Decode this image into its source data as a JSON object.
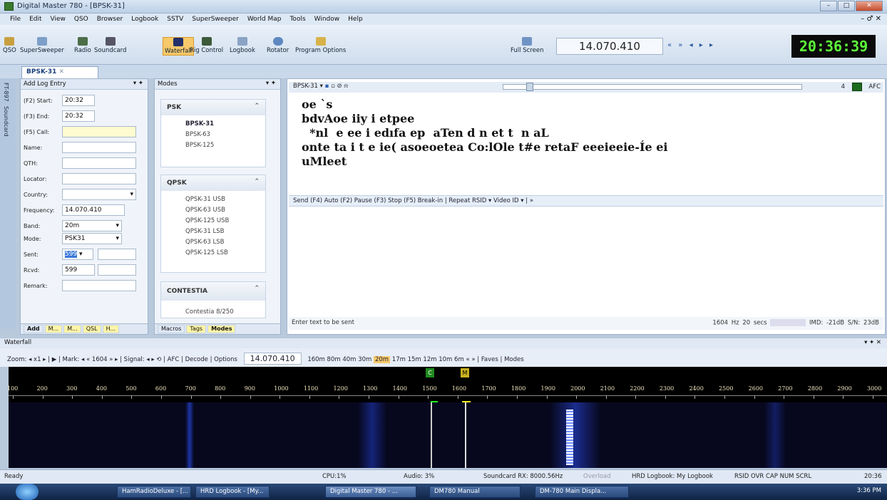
{
  "window": {
    "title": "Digital Master 780 - [BPSK-31]",
    "min": "–",
    "max": "□",
    "close": "✕"
  },
  "menu": [
    "File",
    "Edit",
    "View",
    "QSO",
    "Browser",
    "Logbook",
    "SSTV",
    "SuperSweeper",
    "World Map",
    "Tools",
    "Window",
    "Help"
  ],
  "menu_right": "– ♂ ✕",
  "toolbar": {
    "items": [
      "QSO",
      "SuperSweeper",
      "Radio",
      "Soundcard",
      "Waterfall",
      "Rig Control",
      "Logbook",
      "Rotator",
      "Program Options"
    ],
    "full_screen": "Full Screen",
    "frequency": "14.070.410",
    "clock": "20:36:39",
    "colors": {
      "clock_bg": "#0b0b0b",
      "clock_fg": "#5dff3a"
    }
  },
  "doc_tab": "BPSK-31",
  "vertical_tabs": [
    "FT-897",
    "Soundcard"
  ],
  "log": {
    "title": "Add Log Entry",
    "start_label": "(F2) Start:",
    "start": "20:32",
    "end_label": "(F3) End:",
    "end": "20:32",
    "call_label": "(F5) Call:",
    "name_label": "Name:",
    "qth_label": "QTH:",
    "locator_label": "Locator:",
    "country_label": "Country:",
    "frequency_label": "Frequency:",
    "frequency": "14.070.410",
    "band_label": "Band:",
    "band": "20m",
    "mode_label": "Mode:",
    "mode": "PSK31",
    "sent_label": "Sent:",
    "sent": "599",
    "rcvd_label": "Rcvd:",
    "rcvd": "599",
    "remark_label": "Remark:",
    "tabs": [
      "Add",
      "M...",
      "M...",
      "QSL",
      "H..."
    ]
  },
  "modes": {
    "title": "Modes",
    "groups": [
      {
        "name": "PSK",
        "items": [
          "BPSK-31",
          "BPSK-63",
          "BPSK-125"
        ]
      },
      {
        "name": "QPSK",
        "items": [
          "QPSK-31 USB",
          "QPSK-63 USB",
          "QPSK-125 USB",
          "QPSK-31 LSB",
          "QPSK-63 LSB",
          "QPSK-125 LSB"
        ]
      },
      {
        "name": "CONTESTIA",
        "items": [
          "Contestia 8/250"
        ]
      }
    ],
    "tabs": [
      "Macros",
      "Tags",
      "Modes"
    ]
  },
  "rx": {
    "mode_label": "BPSK-31",
    "afc": "AFC",
    "level": "4",
    "lines": [
      "oe `s",
      "bdvAoe  iiy i etpee",
      "  *nl  e ee i edıfa ep  aTen d n et t  n aL",
      "onte ta  i t e  ie(  asoeoetea  Co:lOle t#e  retaF eeeieeie-Íe ei",
      "uMleet"
    ]
  },
  "tx": {
    "toolbar": "Send (F4)  Auto (F2)  Pause (F3)  Stop (F5)  Break-in  |  Repeat  RSID ▾  Video ID ▾  |  »",
    "status_left": "Enter text to be sent",
    "status_hz": "1604 Hz",
    "status_secs": "20 secs",
    "status_imd": "IMD: -21dB  S/N: 23dB"
  },
  "waterfall": {
    "title": "Waterfall",
    "bar_left": "Zoom:  ◂  x1  ▸  |   ▶  |  Mark:  ◂  «  1604  »  ▸  |  Signal:  ◂  ▸  ⟲  |  AFC  |  Decode  |  Options",
    "frequency": "14.070.410",
    "bands": [
      "160m",
      "80m",
      "40m",
      "30m",
      "20m",
      "17m",
      "15m",
      "12m",
      "10m",
      "6m"
    ],
    "active_band": "20m",
    "bar_right": "« » |  Faves  |  Modes",
    "marker_c": "C",
    "marker_m": "M",
    "scale": [
      "100",
      "200",
      "300",
      "400",
      "500",
      "600",
      "700",
      "800",
      "900",
      "1000",
      "1100",
      "1200",
      "1300",
      "1400",
      "1500",
      "1600",
      "1700",
      "1800",
      "1900",
      "2000",
      "2100",
      "2200",
      "2300",
      "2400",
      "2500",
      "2600",
      "2700",
      "2800",
      "2900",
      "3000"
    ]
  },
  "status": {
    "ready": "Ready",
    "cpu": "CPU:1%",
    "audio": "Audio: 3%",
    "soundcard": "Soundcard RX: 8000.56Hz",
    "overload": "Overload",
    "logbook": "HRD Logbook: My Logbook",
    "flags": "RSID  OVR  CAP  NUM  SCRL",
    "time": "20:36"
  },
  "taskbar": {
    "tasks": [
      "HamRadioDeluxe - [...",
      "HRD Logbook - [My...",
      "Digital Master 780 - ...",
      "DM780 Manual",
      "DM-780 Main Displa..."
    ],
    "tray_time": "3:36 PM"
  }
}
